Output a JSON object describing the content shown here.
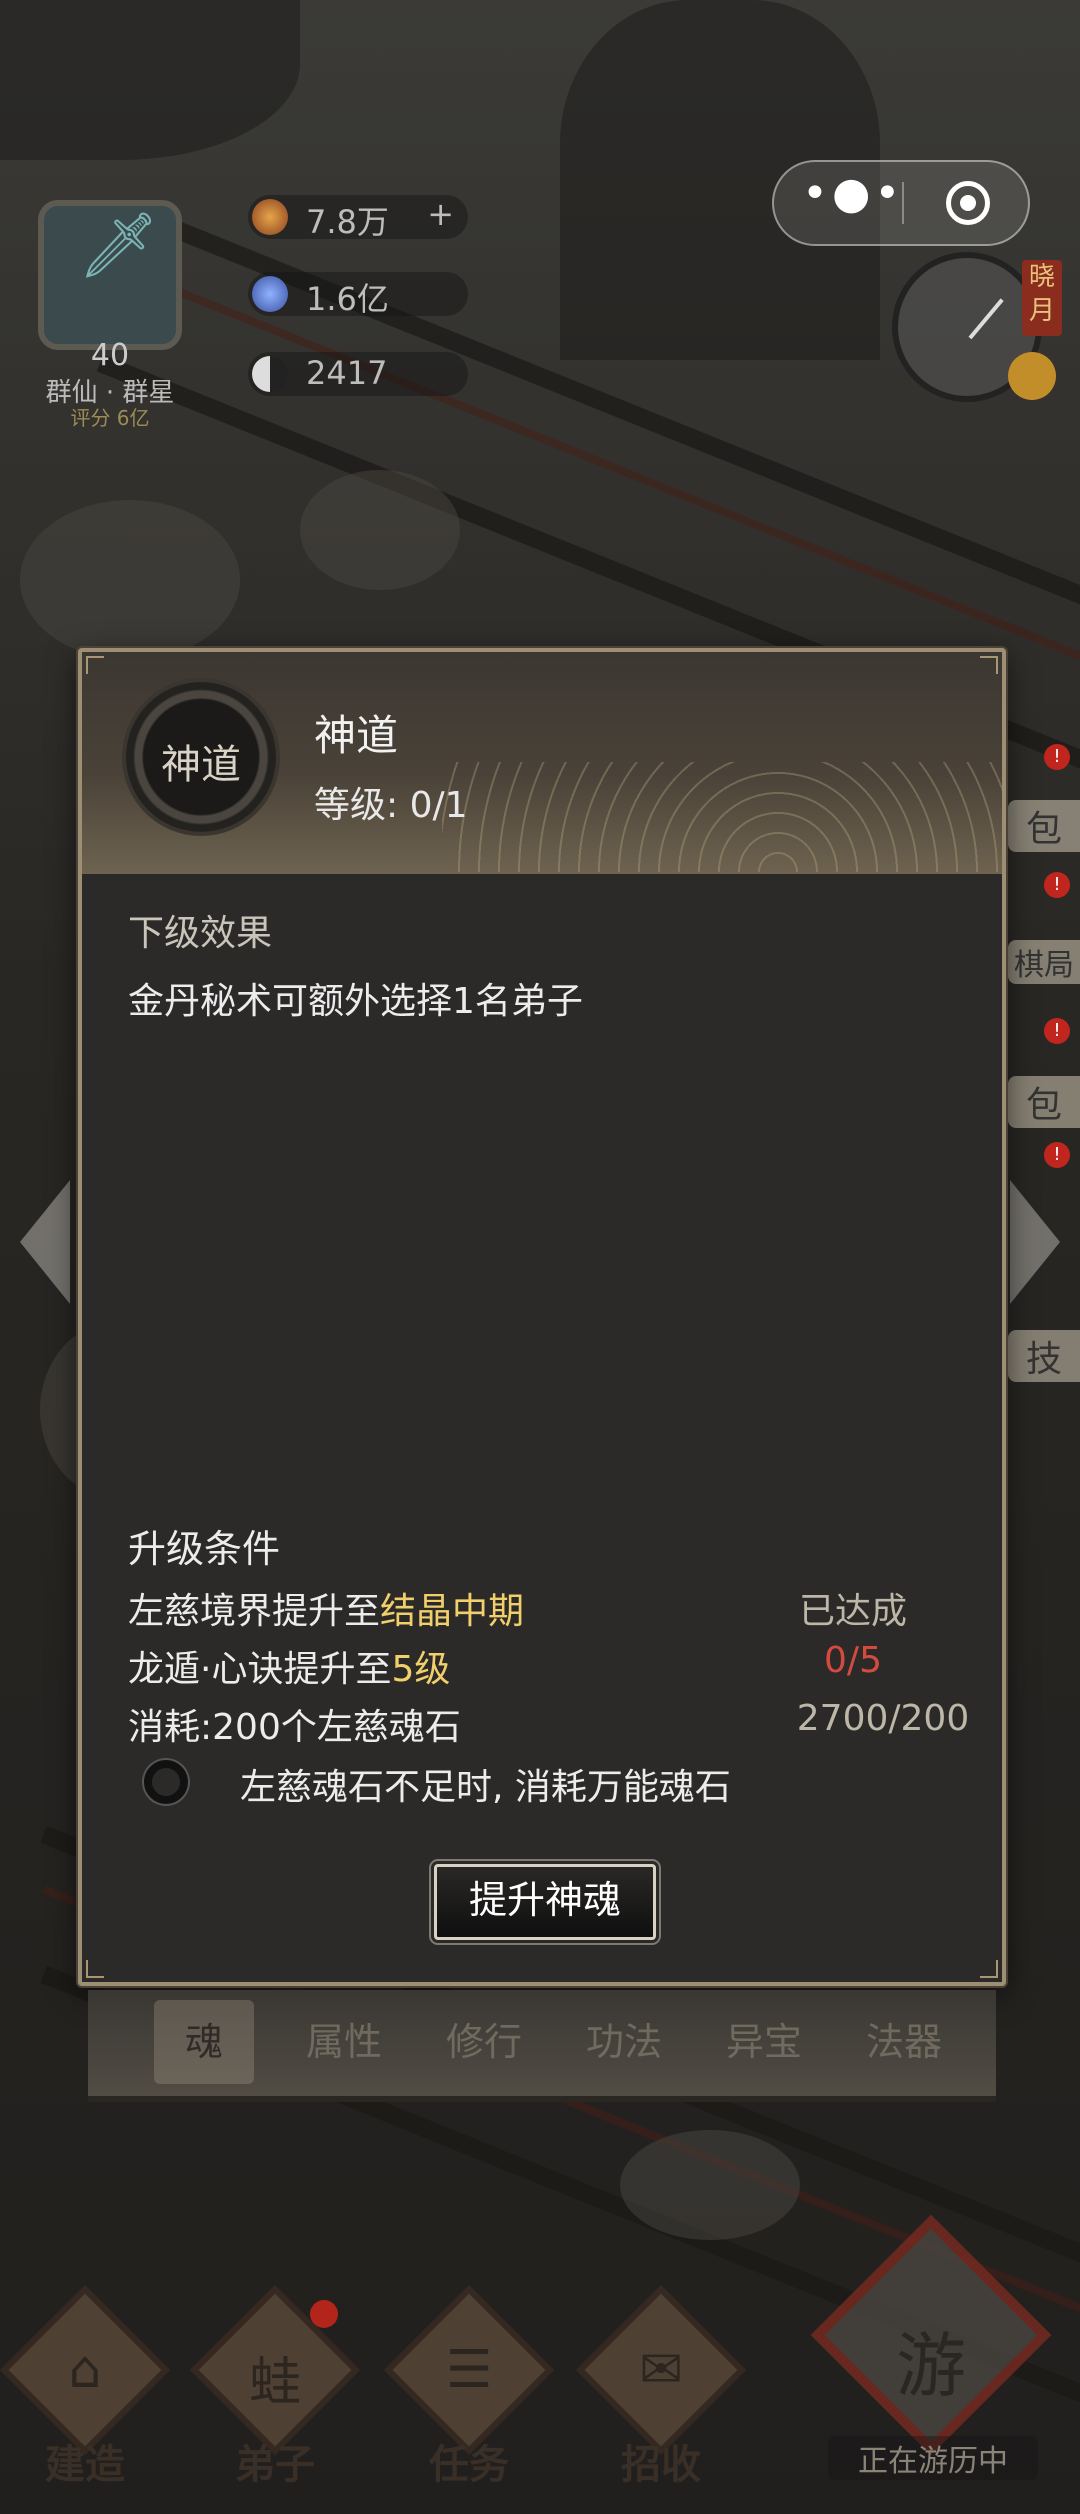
{
  "player": {
    "level": "40",
    "name": "群仙 · 群星",
    "score": "评分 6亿"
  },
  "resources": [
    {
      "icon": "spirit-stone-icon",
      "value": "7.8万",
      "plus": "+",
      "color": "#d07a3a"
    },
    {
      "icon": "crystal-icon",
      "value": "1.6亿",
      "color": "#4e7fd6"
    },
    {
      "icon": "yin-yang-icon",
      "value": "2417",
      "color": "#dddddd"
    }
  ],
  "capsule": {
    "more": "•●•"
  },
  "time": {
    "tag": "晓月"
  },
  "side_menu": [
    "包",
    "棋局",
    "包",
    "技"
  ],
  "modal": {
    "skill_icon_text": "神道",
    "skill_name": "神道",
    "level_label": "等级: 0/1",
    "next_effect_title": "下级效果",
    "next_effect_text": "金丹秘术可额外选择1名弟子",
    "upgrade_title": "升级条件",
    "conditions": [
      {
        "prefix": "左慈境界提升至",
        "highlight": "结晶中期",
        "status": "已达成"
      },
      {
        "prefix": "龙遁·心诀提升至",
        "highlight": "5级",
        "status": "0/5"
      },
      {
        "prefix": "消耗:200个左慈魂石",
        "highlight": "",
        "status": "2700/200"
      }
    ],
    "checkbox_label": "左慈魂石不足时, 消耗万能魂石",
    "button_label": "提升神魂"
  },
  "tabs": [
    "魂",
    "属性",
    "修行",
    "功法",
    "异宝",
    "法器"
  ],
  "dock": [
    {
      "icon": "build-icon",
      "glyph": "⌂",
      "label": "建造"
    },
    {
      "icon": "disciple-icon",
      "glyph": "蛙",
      "label": "弟子"
    },
    {
      "icon": "task-icon",
      "glyph": "☰",
      "label": "任务"
    },
    {
      "icon": "recruit-icon",
      "glyph": "✉",
      "label": "招收"
    }
  ],
  "travel": {
    "glyph": "游",
    "label": "正在游历中"
  }
}
